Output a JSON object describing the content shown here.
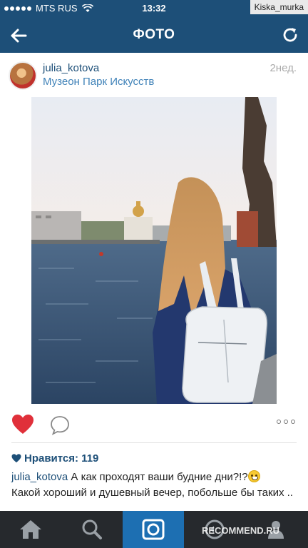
{
  "status_bar": {
    "carrier": "MTS RUS",
    "time": "13:32",
    "watermark": "Kiska_murka"
  },
  "nav": {
    "title": "ФОТО",
    "back_icon": "back-arrow-icon",
    "refresh_icon": "refresh-icon",
    "bg_color": "#1d4f78"
  },
  "post": {
    "username": "julia_kotova",
    "location": "Музеон Парк Искусств",
    "age": "2нед.",
    "likes_label": "Нравится: 119",
    "caption_user": "julia_kotova",
    "caption_text": "А как проходят ваши будние дни?!?",
    "caption_text_2": "Какой хороший и душевный вечер, побольше бы таких .."
  },
  "actions": {
    "like_icon": "heart-icon",
    "comment_icon": "comment-icon",
    "more_icon": "more-icon",
    "like_color": "#e0303a"
  },
  "tab_bar": {
    "items": [
      "home-icon",
      "search-icon",
      "camera-icon",
      "news-icon",
      "profile-icon"
    ],
    "active_index": 2,
    "watermark": "RECOMMEND.RU",
    "active_color": "#1d6fb2"
  }
}
